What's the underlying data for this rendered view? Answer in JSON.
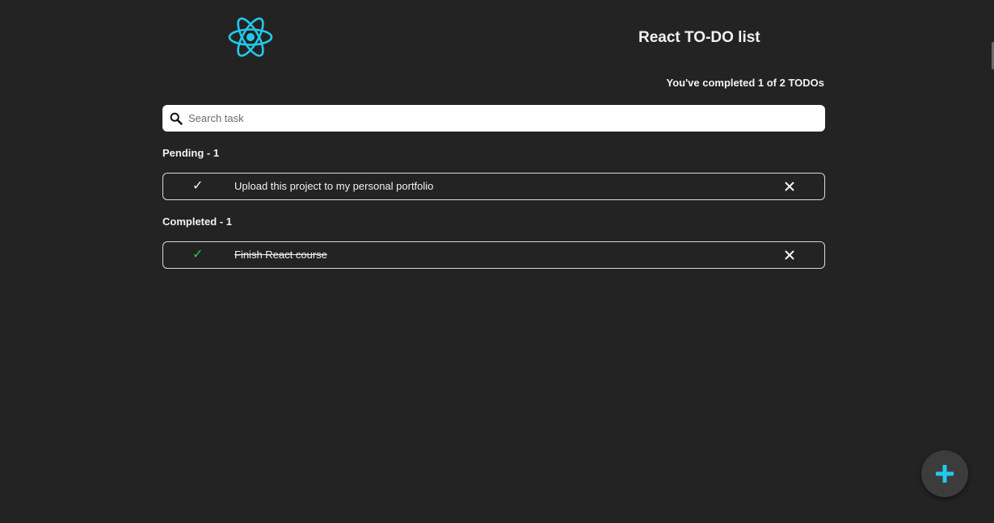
{
  "header": {
    "title": "React TO-DO list",
    "logo_icon": "react-atom-icon",
    "logo_color": "#22c9ec"
  },
  "counter": {
    "text": "You've completed 1 of 2 TODOs"
  },
  "search": {
    "placeholder": "Search task",
    "value": ""
  },
  "sections": {
    "pending": {
      "title": "Pending - 1",
      "items": [
        {
          "text": "Upload this project to my personal portfolio",
          "completed": false
        }
      ]
    },
    "completed": {
      "title": "Completed - 1",
      "items": [
        {
          "text": "Finish React course",
          "completed": true
        }
      ]
    }
  },
  "icons": {
    "check": "✓",
    "delete": "close-icon",
    "add": "plus-icon"
  },
  "colors": {
    "background": "#232323",
    "accent": "#22c9ec",
    "check_done": "#2ecc40",
    "check_pending": "#ffffff"
  }
}
